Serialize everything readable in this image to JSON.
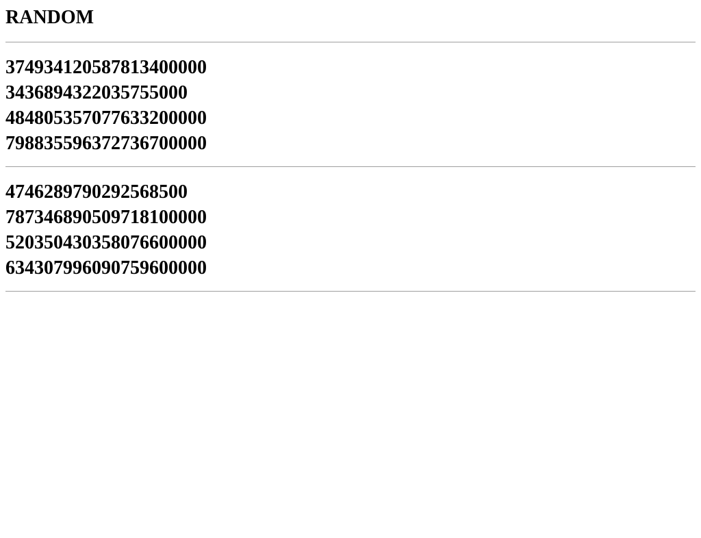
{
  "title": "RANDOM",
  "groups": [
    {
      "numbers": [
        "374934120587813400000",
        "3436894322035755000",
        "484805357077633200000",
        "798835596372736700000"
      ]
    },
    {
      "numbers": [
        "4746289790292568500",
        "787346890509718100000",
        "520350430358076600000",
        "634307996090759600000"
      ]
    }
  ]
}
